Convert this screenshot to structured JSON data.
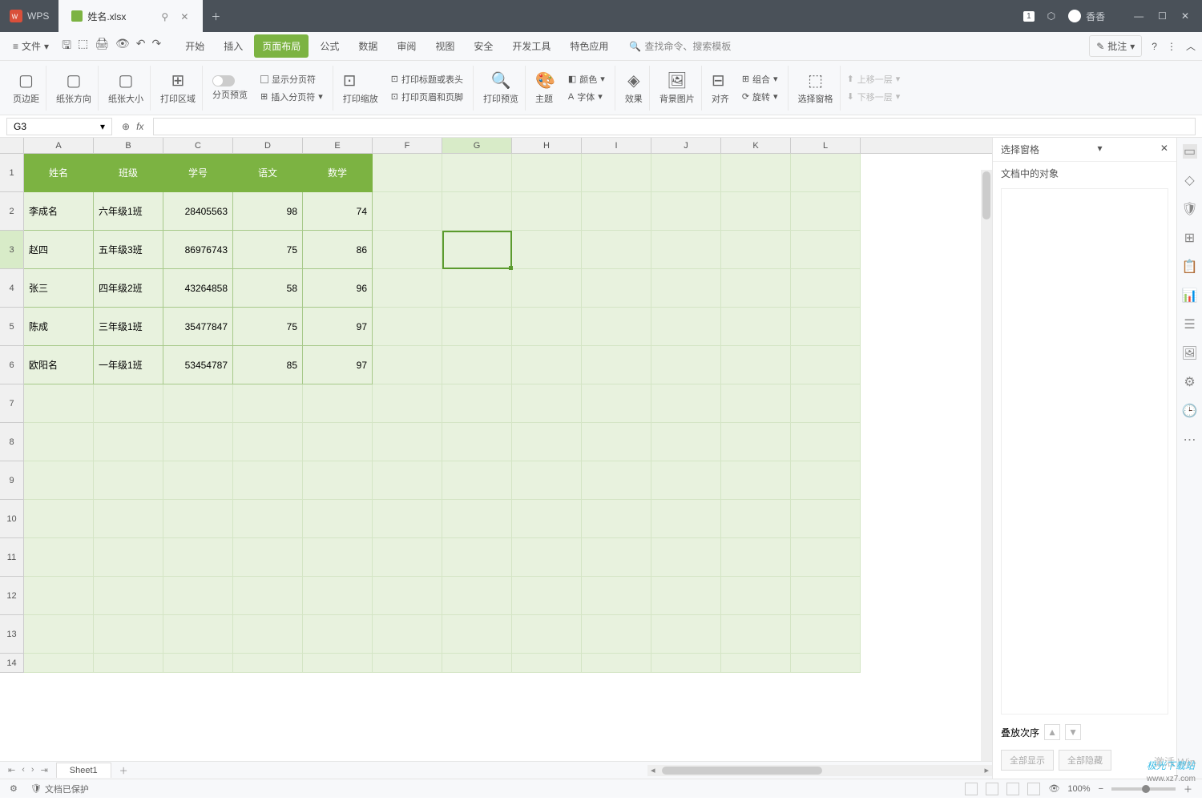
{
  "app_name": "WPS",
  "document_tab": "姓名.xlsx",
  "user_name": "香香",
  "notification_badge": "1",
  "menu": {
    "file": "文件",
    "tabs": [
      "开始",
      "插入",
      "页面布局",
      "公式",
      "数据",
      "审阅",
      "视图",
      "安全",
      "开发工具",
      "特色应用"
    ],
    "active_tab_index": 2,
    "search_placeholder": "查找命令、搜索模板",
    "comments": "批注"
  },
  "ribbon": {
    "margin": "页边距",
    "orientation": "纸张方向",
    "size": "纸张大小",
    "print_area": "打印区域",
    "page_break_preview": "分页预览",
    "show_page_break": "显示分页符",
    "insert_page_break": "插入分页符",
    "print_title_header": "打印标题或表头",
    "print_header_footer": "打印页眉和页脚",
    "print_scale": "打印缩放",
    "print_preview": "打印预览",
    "theme": "主题",
    "color": "颜色",
    "font": "字体",
    "effect": "效果",
    "bg_image": "背景图片",
    "align": "对齐",
    "group": "组合",
    "rotate": "旋转",
    "select_pane": "选择窗格",
    "move_up": "上移一层",
    "move_down": "下移一层"
  },
  "cell_ref": "G3",
  "columns": [
    "A",
    "B",
    "C",
    "D",
    "E",
    "F",
    "G",
    "H",
    "I",
    "J",
    "K",
    "L"
  ],
  "active_col": "G",
  "active_row": 3,
  "table": {
    "headers": [
      "姓名",
      "班级",
      "学号",
      "语文",
      "数学"
    ],
    "rows": [
      {
        "name": "李成名",
        "class": "六年级1班",
        "id": "28405563",
        "chinese": "98",
        "math": "74"
      },
      {
        "name": "赵四",
        "class": "五年级3班",
        "id": "86976743",
        "chinese": "75",
        "math": "86"
      },
      {
        "name": "张三",
        "class": "四年级2班",
        "id": "43264858",
        "chinese": "58",
        "math": "96"
      },
      {
        "name": "陈成",
        "class": "三年级1班",
        "id": "35477847",
        "chinese": "75",
        "math": "97"
      },
      {
        "name": "欧阳名",
        "class": "一年级1班",
        "id": "53454787",
        "chinese": "85",
        "math": "97"
      }
    ]
  },
  "row_numbers": [
    1,
    2,
    3,
    4,
    5,
    6,
    7,
    8,
    9,
    10,
    11,
    12,
    13,
    14
  ],
  "panel": {
    "title": "选择窗格",
    "subtitle": "文档中的对象",
    "stack_order": "叠放次序",
    "show_all": "全部显示",
    "hide_all": "全部隐藏"
  },
  "sheet_name": "Sheet1",
  "status": {
    "protected": "文档已保护",
    "zoom": "100%"
  },
  "watermark": "激活 Win",
  "watermark2": "极光下载站",
  "watermark3": "www.xz7.com"
}
